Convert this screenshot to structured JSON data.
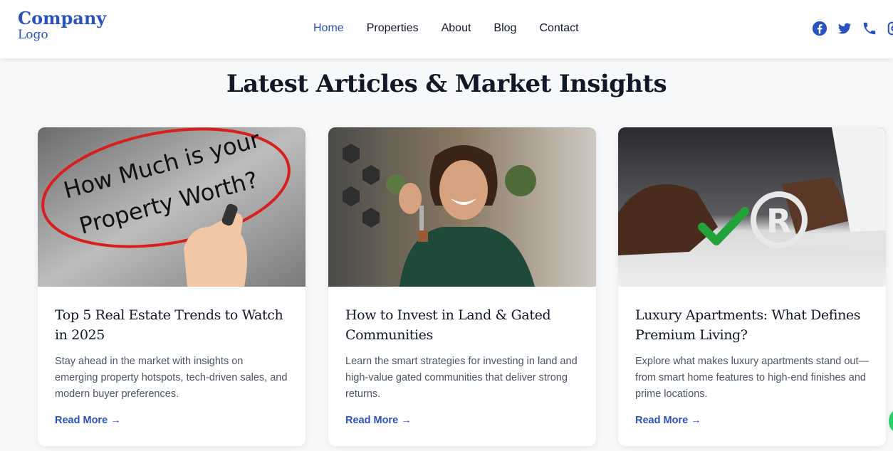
{
  "header": {
    "logo_line1": "Company",
    "logo_line2": "Logo",
    "nav": [
      "Home",
      "Properties",
      "About",
      "Blog",
      "Contact"
    ],
    "active_nav": "Home",
    "social_icons": [
      "facebook-icon",
      "twitter-icon",
      "phone-icon",
      "instagram-icon"
    ]
  },
  "section": {
    "title": "Latest Articles & Market Insights"
  },
  "articles": [
    {
      "title": "Top 5 Real Estate Trends to Watch in 2025",
      "excerpt": "Stay ahead in the market with insights on emerging property hotspots, tech-driven sales, and modern buyer preferences.",
      "link": "Read More →",
      "image_text": [
        "How Much is your",
        "Property Worth?"
      ]
    },
    {
      "title": "How to Invest in Land & Gated Communities",
      "excerpt": "Learn the smart strategies for investing in land and high-value gated communities that deliver strong returns.",
      "link": "Read More →"
    },
    {
      "title": "Luxury Apartments: What Defines Premium Living?",
      "excerpt": "Explore what makes luxury apartments stand out—from smart home features to high-end finishes and prime locations.",
      "link": "Read More →"
    }
  ],
  "colors": {
    "accent": "#2a52be",
    "text": "#111827",
    "muted": "#4b5563",
    "bg": "#f7f8fa"
  }
}
